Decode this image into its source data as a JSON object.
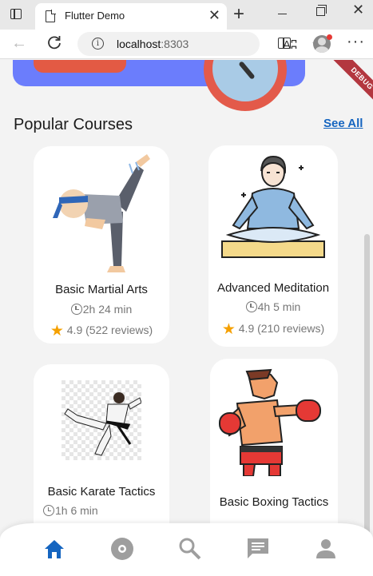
{
  "browser": {
    "tab_title": "Flutter Demo",
    "tab_close": "✕",
    "new_tab": "+",
    "minimize": "—",
    "close_window": "✕",
    "url_host": "localhost",
    "url_port": ":8303",
    "read_aloud": "Aʭ",
    "more": "···"
  },
  "app": {
    "debug_banner": "DEBUG",
    "section_title": "Popular Courses",
    "see_all": "See All",
    "courses": [
      {
        "name": "Basic Martial Arts",
        "duration": "2h 24 min",
        "rating": "4.9 (522 reviews)"
      },
      {
        "name": "Advanced Meditation",
        "duration": "4h 5 min",
        "rating": "4.9 (210 reviews)"
      },
      {
        "name": "Basic Karate Tactics",
        "duration": "1h 6 min"
      },
      {
        "name": "Basic Boxing Tactics"
      }
    ],
    "bottom_nav": [
      "home-icon",
      "explore-icon",
      "search-icon",
      "chat-icon",
      "profile-icon"
    ],
    "colors": {
      "accent": "#1565c0",
      "active_nav": "#1565c0",
      "inactive_nav": "#9e9e9e",
      "star": "#f5a000",
      "banner": "#6b7dfc"
    }
  }
}
